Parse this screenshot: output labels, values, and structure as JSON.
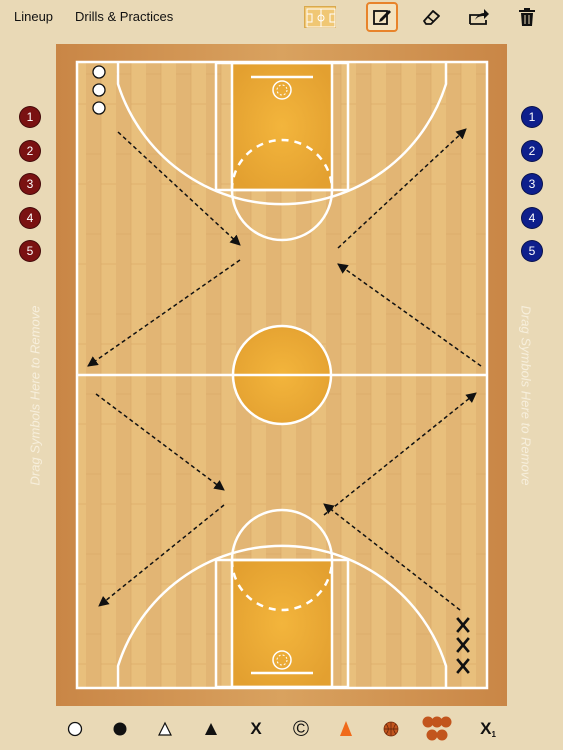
{
  "nav": {
    "lineup_label": "Lineup",
    "drills_label": "Drills & Practices"
  },
  "toolbar": {
    "tools": [
      "court-thumbnail-icon",
      "edit-icon",
      "eraser-icon",
      "share-icon",
      "trash-icon"
    ],
    "active_tool": "edit-icon",
    "accent_color": "#e8832a"
  },
  "players": {
    "left_team": {
      "color": "#7a1212",
      "numbers": [
        "1",
        "2",
        "3",
        "4",
        "5"
      ]
    },
    "right_team": {
      "color": "#0e1f8c",
      "numbers": [
        "1",
        "2",
        "3",
        "4",
        "5"
      ]
    }
  },
  "remove_zone": {
    "left_label": "Drag Symbols Here to Remove",
    "right_label": "Drag Symbols Here to Remove"
  },
  "court": {
    "top_markers": [
      "circle",
      "circle",
      "circle"
    ],
    "bottom_markers": [
      "X",
      "X",
      "X"
    ]
  },
  "symbols": {
    "x_label": "X",
    "c_label": "©",
    "x1_label": "X",
    "x1_sub": "1"
  }
}
